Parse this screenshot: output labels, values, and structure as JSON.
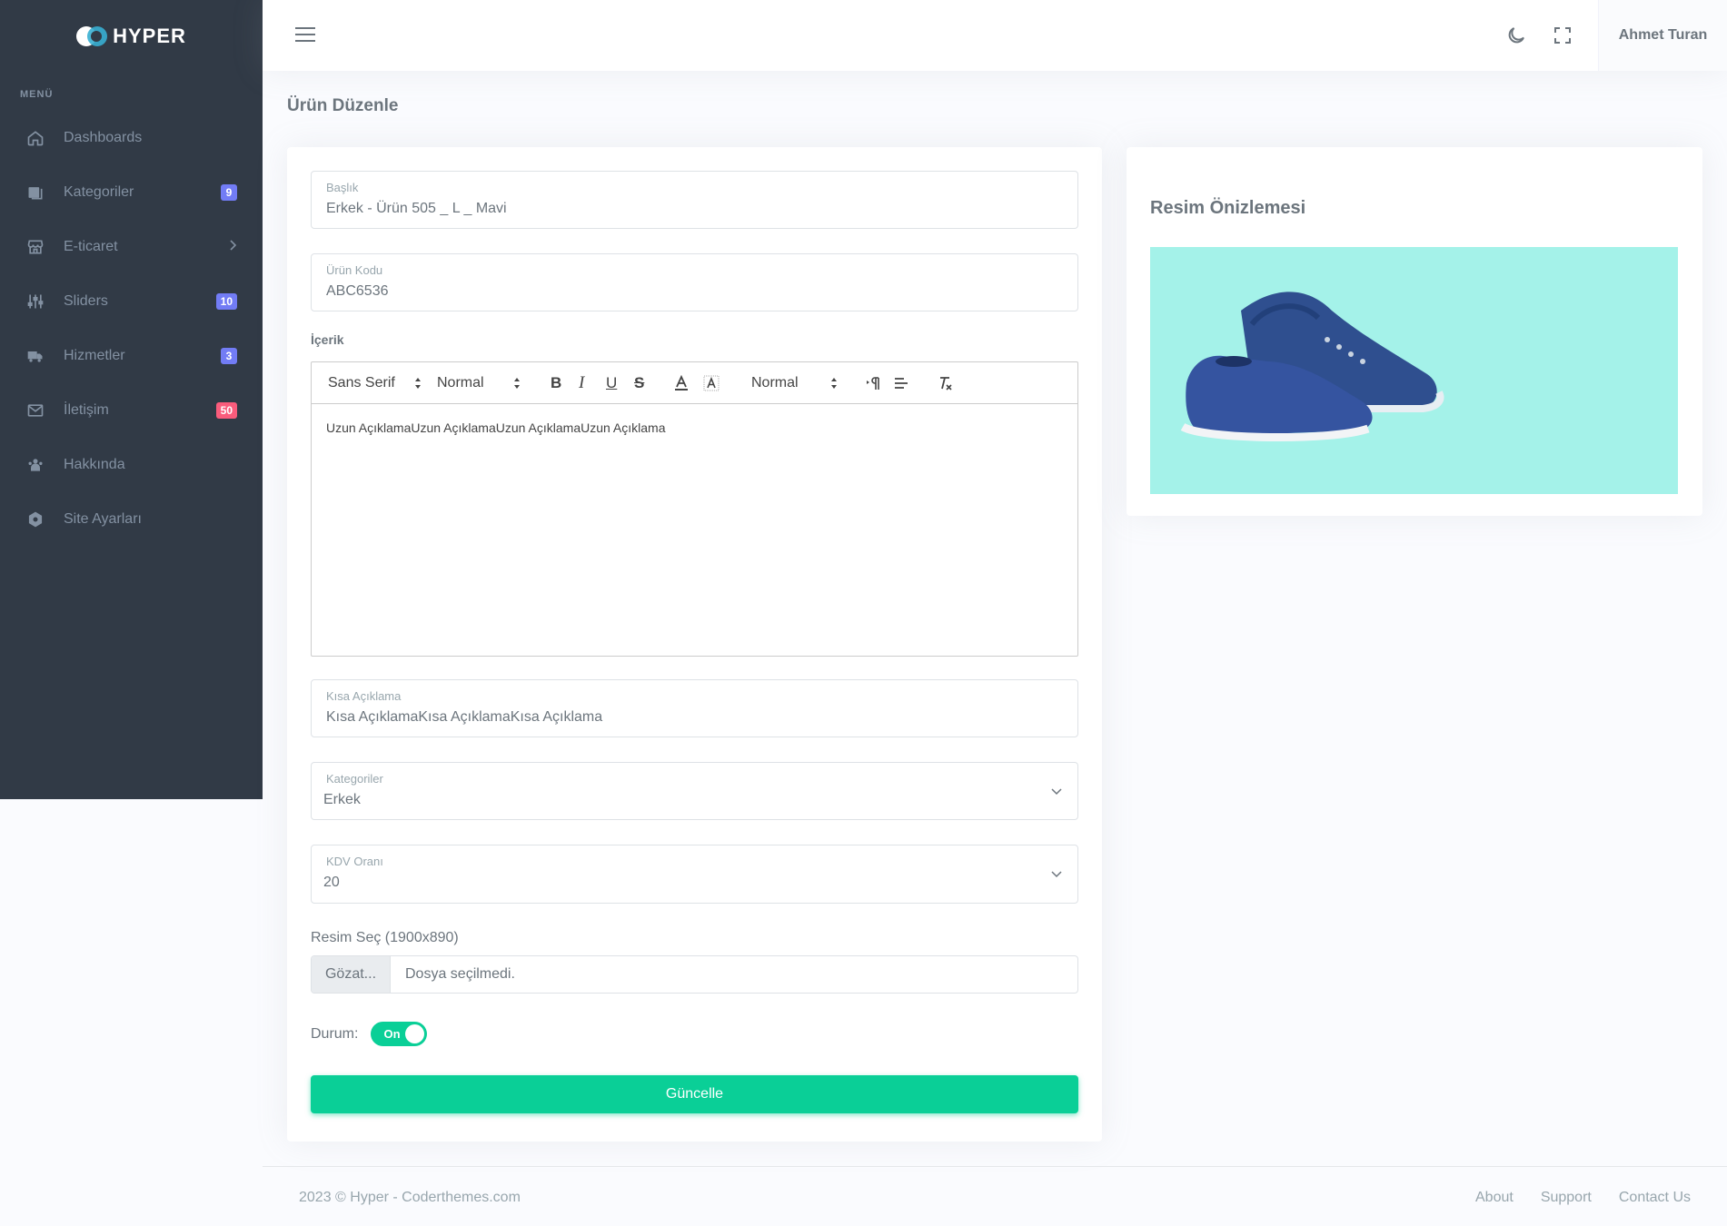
{
  "brand": {
    "name": "HYPER"
  },
  "sidebar": {
    "menu_title": "MENÜ",
    "items": [
      {
        "label": "Dashboards",
        "icon": "home-icon",
        "badge": ""
      },
      {
        "label": "Kategoriler",
        "icon": "layers-icon",
        "badge": "9",
        "badge_color": "#727cf5"
      },
      {
        "label": "E-ticaret",
        "icon": "store-icon",
        "badge": ""
      },
      {
        "label": "Sliders",
        "icon": "sliders-icon",
        "badge": "10",
        "badge_color": "#727cf5"
      },
      {
        "label": "Hizmetler",
        "icon": "truck-icon",
        "badge": "3",
        "badge_color": "#727cf5"
      },
      {
        "label": "İletişim",
        "icon": "mail-icon",
        "badge": "50",
        "badge_color": "#fa5c7c"
      },
      {
        "label": "Hakkında",
        "icon": "users-icon",
        "badge": ""
      },
      {
        "label": "Site Ayarları",
        "icon": "settings-icon",
        "badge": ""
      }
    ]
  },
  "topbar": {
    "user_name": "Ahmet Turan"
  },
  "page": {
    "title": "Ürün Düzenle"
  },
  "form": {
    "baslik": {
      "label": "Başlık",
      "value": "Erkek - Ürün 505 _ L _ Mavi"
    },
    "urun_kodu": {
      "label": "Ürün Kodu",
      "value": "ABC6536"
    },
    "icerik": {
      "label": "İçerik",
      "font": "Sans Serif",
      "size": "Normal",
      "header": "Normal",
      "text": "Uzun AçıklamaUzun AçıklamaUzun AçıklamaUzun Açıklama"
    },
    "kisa_aciklama": {
      "label": "Kısa Açıklama",
      "value": "Kısa AçıklamaKısa AçıklamaKısa Açıklama"
    },
    "kategoriler": {
      "label": "Kategoriler",
      "value": "Erkek"
    },
    "kdv": {
      "label": "KDV Oranı",
      "value": "20"
    },
    "resim": {
      "label": "Resim Seç (1900x890)",
      "button": "Gözat...",
      "placeholder": "Dosya seçilmedi."
    },
    "durum": {
      "label": "Durum:",
      "state": "On"
    },
    "submit": "Güncelle"
  },
  "preview": {
    "title": "Resim Önizlemesi"
  },
  "footer": {
    "copyright": "2023 © Hyper - Coderthemes.com",
    "links": [
      "About",
      "Support",
      "Contact Us"
    ]
  },
  "colors": {
    "accent": "#0acf97",
    "sidebar": "#313a46",
    "badge_primary": "#727cf5",
    "badge_danger": "#fa5c7c",
    "preview_bg": "#a4f2e9"
  }
}
